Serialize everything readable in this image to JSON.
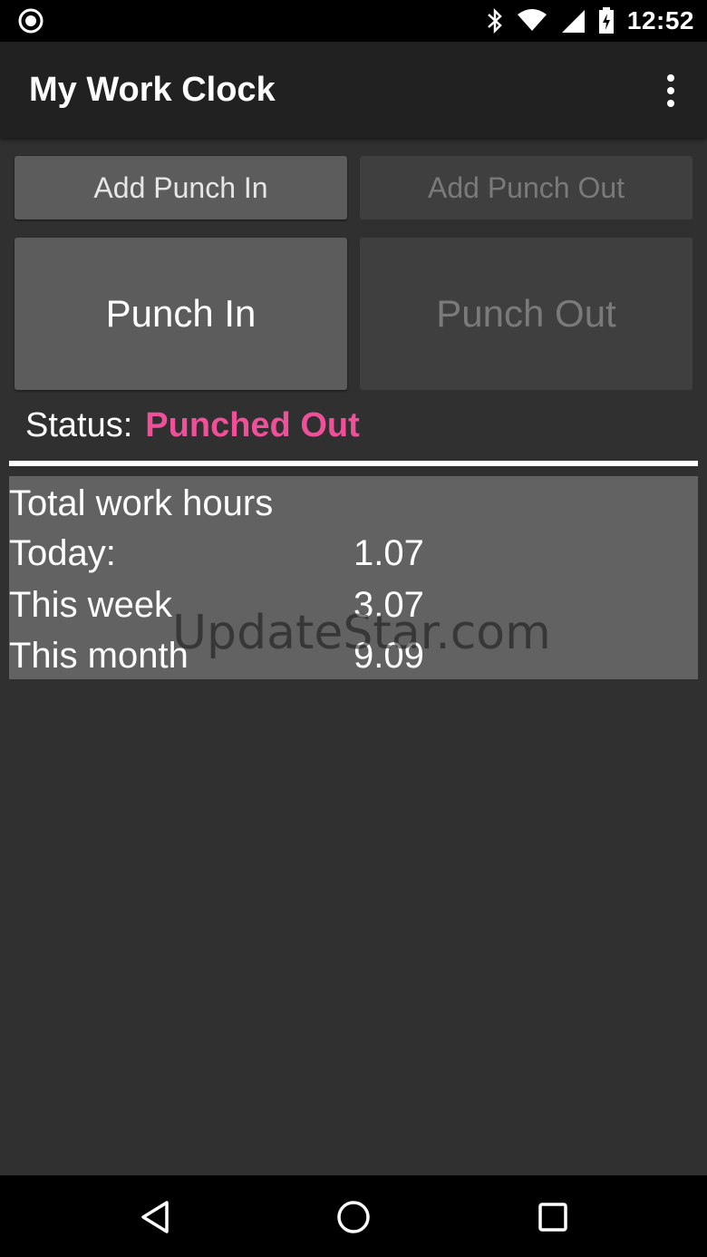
{
  "statusbar": {
    "time": "12:52",
    "icons": [
      "camera-icon",
      "bluetooth-icon",
      "wifi-icon",
      "signal-icon",
      "battery-icon"
    ]
  },
  "appbar": {
    "title": "My Work Clock",
    "menu_icon": "overflow-menu-icon"
  },
  "buttons": {
    "add_punch_in": "Add Punch In",
    "add_punch_out": "Add Punch Out",
    "punch_in": "Punch In",
    "punch_out": "Punch Out"
  },
  "status": {
    "label": "Status:",
    "value": "Punched Out",
    "value_color": "#f0509a"
  },
  "hours": {
    "title": "Total work hours",
    "rows": [
      {
        "label": "Today:",
        "value": "1.07"
      },
      {
        "label": "This week",
        "value": "3.07"
      },
      {
        "label": "This month",
        "value": "9.09"
      }
    ]
  },
  "watermark": "UpdateStar.com",
  "navbar": {
    "icons": [
      "back-icon",
      "home-icon",
      "recents-icon"
    ]
  }
}
